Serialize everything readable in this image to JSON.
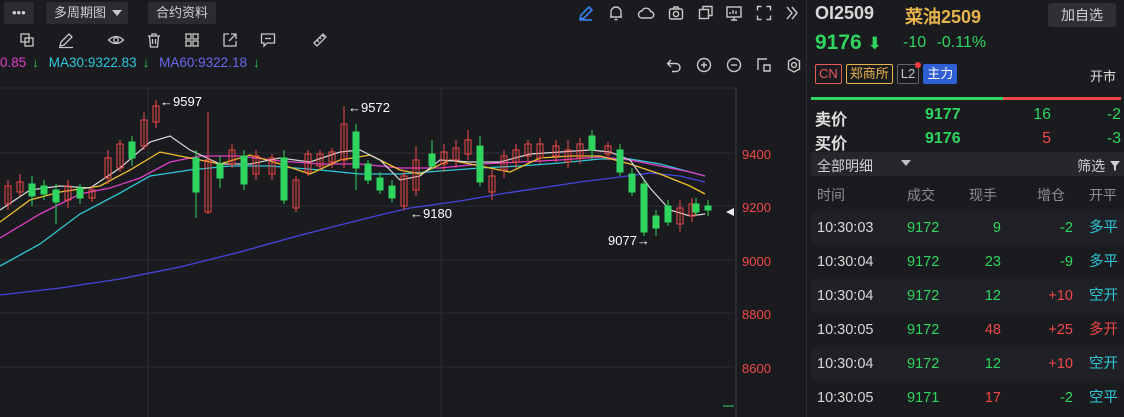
{
  "toolbar": {
    "more_label": "•••",
    "period_label": "多周期图",
    "contract_info_label": "合约资料"
  },
  "ma_legend": {
    "ma_partial": "0.85",
    "ma30": "MA30:9322.83",
    "ma60": "MA60:9322.18",
    "arrow": "↓"
  },
  "chart": {
    "price_labels": [
      "9400",
      "9200",
      "9000",
      "8800",
      "8600"
    ],
    "annotations": {
      "high1": "←9597",
      "high2": "←9572",
      "low1": "←9180",
      "low2": "9077→"
    },
    "colors": {
      "up": "#f04848",
      "down": "#2fd55f",
      "ma_short": "#ffffff",
      "ma_yellow": "#f2c02f",
      "ma_pink": "#e040c8",
      "ma_cyan": "#2ec8d8",
      "ma_blue": "#4646e0"
    }
  },
  "quote": {
    "symbol": "OI2509",
    "name": "菜油2509",
    "add_label": "加自选",
    "last_price": "9176",
    "down_arrow": "⬇",
    "change": "-10",
    "change_pct": "-0.11%",
    "tags": {
      "cn": "CN",
      "exchange": "郑商所",
      "l2": "L2",
      "main": "主力"
    },
    "status": "开市",
    "buy_ratio": 0.62
  },
  "order_book": {
    "ask": {
      "label": "卖价",
      "price": "9177",
      "volume": "16",
      "delta": "-2"
    },
    "bid": {
      "label": "买价",
      "price": "9176",
      "volume": "5",
      "delta": "-3"
    }
  },
  "detail": {
    "title": "全部明细",
    "filter_label": "筛选",
    "headers": [
      "时间",
      "成交",
      "现手",
      "增仓",
      "开平"
    ],
    "rows": [
      {
        "time": "10:30:03",
        "price": "9172",
        "vol": "9",
        "oi": "-2",
        "type": "多平",
        "vol_color": "green",
        "oi_color": "green",
        "type_color": "cyan"
      },
      {
        "time": "10:30:04",
        "price": "9172",
        "vol": "23",
        "oi": "-9",
        "type": "多平",
        "vol_color": "green",
        "oi_color": "green",
        "type_color": "cyan"
      },
      {
        "time": "10:30:04",
        "price": "9172",
        "vol": "12",
        "oi": "+10",
        "type": "空开",
        "vol_color": "green",
        "oi_color": "red",
        "type_color": "cyan"
      },
      {
        "time": "10:30:05",
        "price": "9172",
        "vol": "48",
        "oi": "+25",
        "type": "多开",
        "vol_color": "red",
        "oi_color": "red",
        "type_color": "red"
      },
      {
        "time": "10:30:04",
        "price": "9172",
        "vol": "12",
        "oi": "+10",
        "type": "空开",
        "vol_color": "green",
        "oi_color": "red",
        "type_color": "cyan"
      },
      {
        "time": "10:30:05",
        "price": "9171",
        "vol": "17",
        "oi": "-2",
        "type": "空平",
        "vol_color": "red",
        "oi_color": "green",
        "type_color": "cyan"
      }
    ]
  }
}
